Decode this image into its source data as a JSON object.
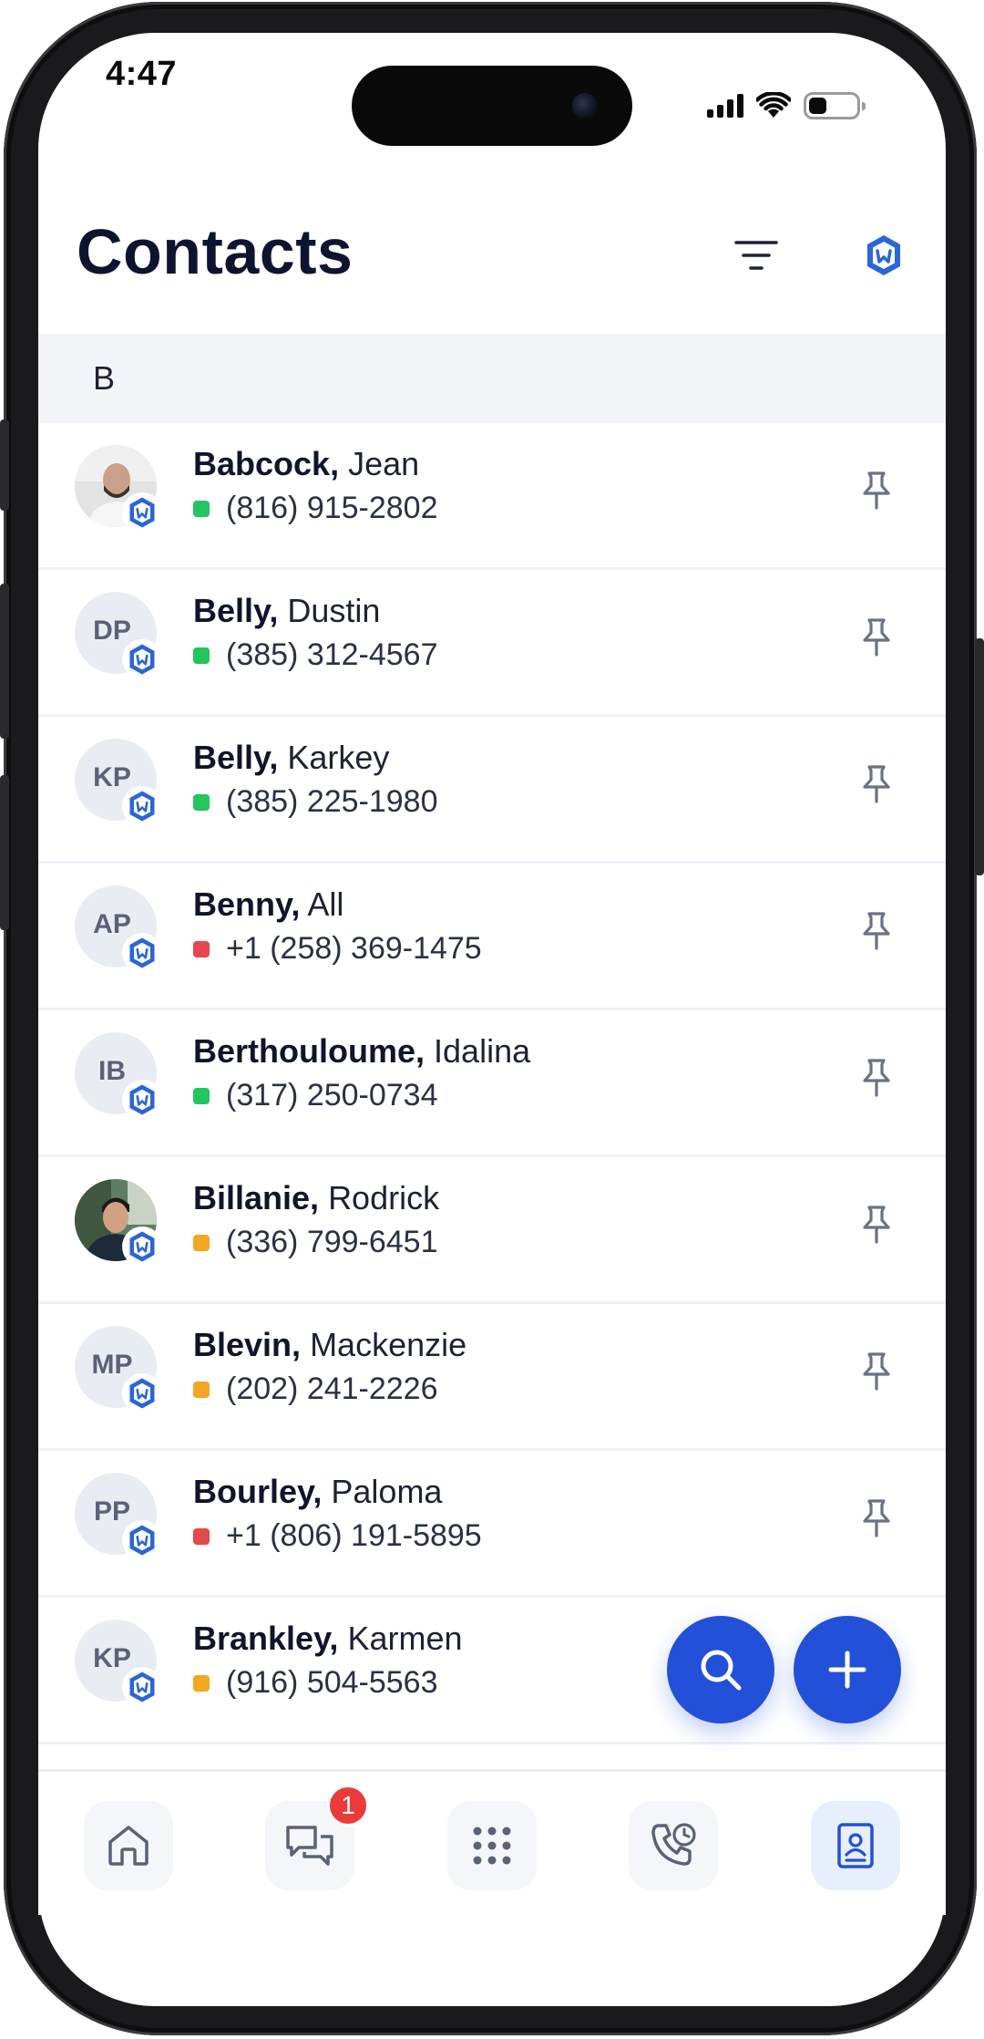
{
  "status_bar": {
    "time": "4:47"
  },
  "header": {
    "title": "Contacts"
  },
  "section_letter": "B",
  "colors": {
    "accent": "#2350d8",
    "status_green": "#22c55e",
    "status_red": "#e5484d",
    "status_orange": "#f5a623",
    "title": "#0e1430"
  },
  "contacts": [
    {
      "last": "Babcock,",
      "first": "Jean",
      "phone": "(816) 915-2802",
      "status": "green",
      "initials": "",
      "avatar": "photo-man-beard"
    },
    {
      "last": "Belly,",
      "first": "Dustin",
      "phone": "(385) 312-4567",
      "status": "green",
      "initials": "DP",
      "avatar": "initials"
    },
    {
      "last": "Belly,",
      "first": "Karkey",
      "phone": "(385) 225-1980",
      "status": "green",
      "initials": "KP",
      "avatar": "initials"
    },
    {
      "last": "Benny,",
      "first": "All",
      "phone": "+1 (258) 369-1475",
      "status": "red",
      "initials": "AP",
      "avatar": "initials"
    },
    {
      "last": "Berthouloume,",
      "first": "Idalina",
      "phone": "(317) 250-0734",
      "status": "green",
      "initials": "IB",
      "avatar": "initials"
    },
    {
      "last": "Billanie,",
      "first": "Rodrick",
      "phone": "(336) 799-6451",
      "status": "orange",
      "initials": "",
      "avatar": "photo-man-smiling"
    },
    {
      "last": "Blevin,",
      "first": "Mackenzie",
      "phone": "(202) 241-2226",
      "status": "orange",
      "initials": "MP",
      "avatar": "initials"
    },
    {
      "last": "Bourley,",
      "first": "Paloma",
      "phone": "+1 (806) 191-5895",
      "status": "red",
      "initials": "PP",
      "avatar": "initials"
    },
    {
      "last": "Brankley,",
      "first": "Karmen",
      "phone": "(916) 504-5563",
      "status": "orange",
      "initials": "KP",
      "avatar": "initials"
    }
  ],
  "nav": {
    "items": [
      {
        "name": "home",
        "icon": "home-icon"
      },
      {
        "name": "messages",
        "icon": "chat-icon",
        "badge": "1"
      },
      {
        "name": "dialpad",
        "icon": "dialpad-icon"
      },
      {
        "name": "recents",
        "icon": "phone-history-icon"
      },
      {
        "name": "contacts",
        "icon": "contact-book-icon",
        "active": true
      }
    ]
  }
}
